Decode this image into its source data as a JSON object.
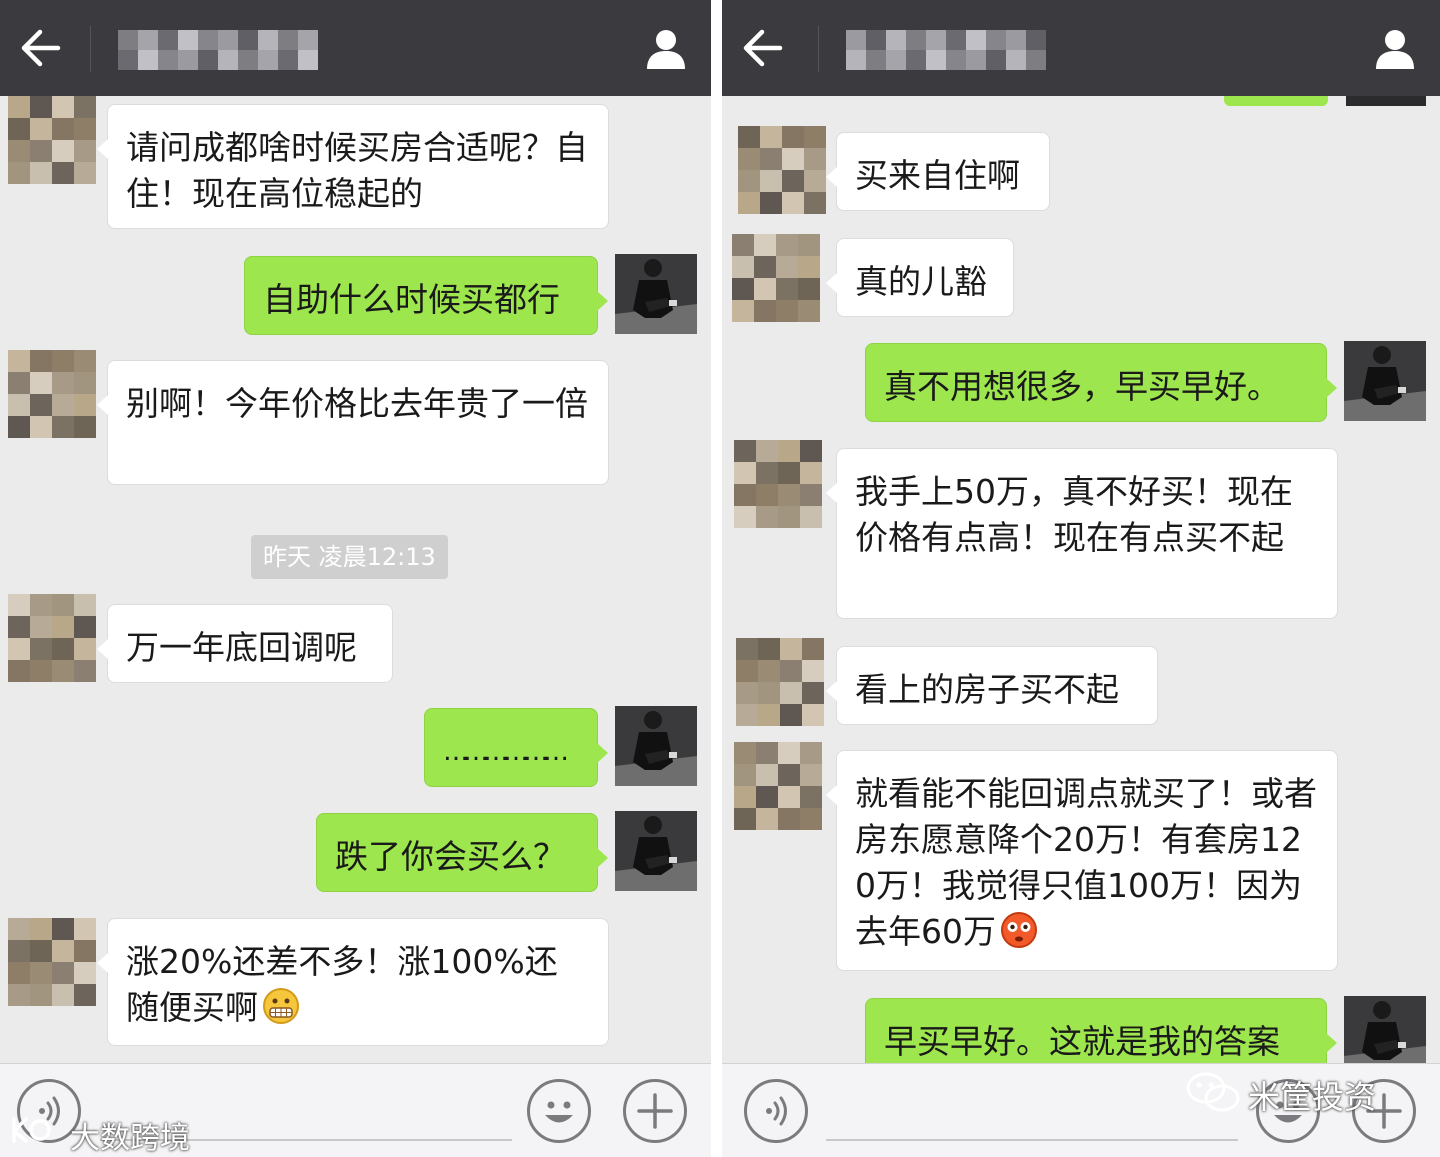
{
  "left": {
    "messages": [
      {
        "type": "in",
        "text": "请问成都啥时候买房合适呢？自住！现在高位稳起的"
      },
      {
        "type": "out",
        "text": "自助什么时候买都行"
      },
      {
        "type": "in",
        "text": "别啊！今年价格比去年贵了一倍"
      },
      {
        "type": "time",
        "text": "昨天 凌晨12:13"
      },
      {
        "type": "in",
        "text": "万一年底回调呢"
      },
      {
        "type": "out",
        "text": "………………"
      },
      {
        "type": "out",
        "text": "跌了你会买么？"
      },
      {
        "type": "in",
        "text": "涨20%还差不多！涨100%还随便买啊",
        "emoji": "grimace-emoji"
      }
    ]
  },
  "right": {
    "messages": [
      {
        "type": "in",
        "text": "买来自住啊"
      },
      {
        "type": "in",
        "text": "真的儿豁"
      },
      {
        "type": "out",
        "text": "真不用想很多，早买早好。"
      },
      {
        "type": "in",
        "text": "我手上50万，真不好买！现在价格有点高！现在有点买不起"
      },
      {
        "type": "in",
        "text": "看上的房子买不起"
      },
      {
        "type": "in",
        "text": "就看能不能回调点就买了！或者房东愿意降个20万！有套房120万！我觉得只值100万！因为去年60万",
        "emoji": "flushed-emoji"
      },
      {
        "type": "out",
        "text": "早买早好。这就是我的答案"
      }
    ]
  },
  "watermarks": {
    "left": "大数跨境",
    "right": "米筐投资"
  },
  "icons": {
    "back": "back-arrow-icon",
    "profile": "profile-icon",
    "voice": "voice-icon",
    "emoji": "emoji-icon",
    "plus": "plus-icon"
  },
  "colors": {
    "topbar": "#3a3a3f",
    "background": "#ebebeb",
    "bubble_out": "#9de64e",
    "bubble_in": "#ffffff",
    "timestamp_bg": "#cfcfcf"
  }
}
